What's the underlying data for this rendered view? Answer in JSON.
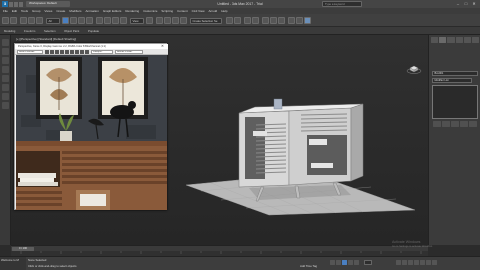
{
  "titlebar": {
    "app_tab": "Workspaces: Default",
    "title": "Untitled - 3ds Max 2017 - Trial",
    "search_placeholder": "Type a keyword",
    "minimize": "–",
    "maximize": "□",
    "close": "✕"
  },
  "menu": [
    "File",
    "Edit",
    "Tools",
    "Group",
    "Views",
    "Create",
    "Modifiers",
    "Animation",
    "Graph Editors",
    "Rendering",
    "Customize",
    "Scripting",
    "Content",
    "Civil View",
    "Arnold",
    "Help"
  ],
  "toolbar": {
    "selection_filter": "All",
    "coord_system": "View",
    "named_selection": "Create Selection Se"
  },
  "ribbon_tabs": [
    "Modeling",
    "Freeform",
    "Selection",
    "Object Paint",
    "Populate"
  ],
  "viewport_label": "[+] [Perspective] [Standard] [Default Shading]",
  "floating_window": {
    "title": "Perspective, frame 0, Display Gamma: 2.2, RGBA Color 8 Bits/Channel (1:1)",
    "area_select": "Area to Render",
    "viewport_select": "Viewport:",
    "preset_select": "Render Preset:",
    "close": "✕"
  },
  "command_panel": {
    "object_name": "Box001",
    "modifier_list": "Modifier List"
  },
  "timeline": {
    "slider": "0 / 100"
  },
  "status": {
    "selection": "None Selected",
    "prompt": "Click or click-and-drag to select objects",
    "welcome": "Welcome to M",
    "add_time_tag": "Add Time Tag"
  },
  "watermark": {
    "line1": "Activate Windows",
    "line2": "Go to Settings to activate Windows."
  },
  "colors": {
    "background": "#2b2b2b",
    "accent_blue": "#4a7fc1",
    "furniture": "#cfcfcf",
    "render_wall": "#3c4046",
    "render_wood": "#8a5a3a"
  }
}
